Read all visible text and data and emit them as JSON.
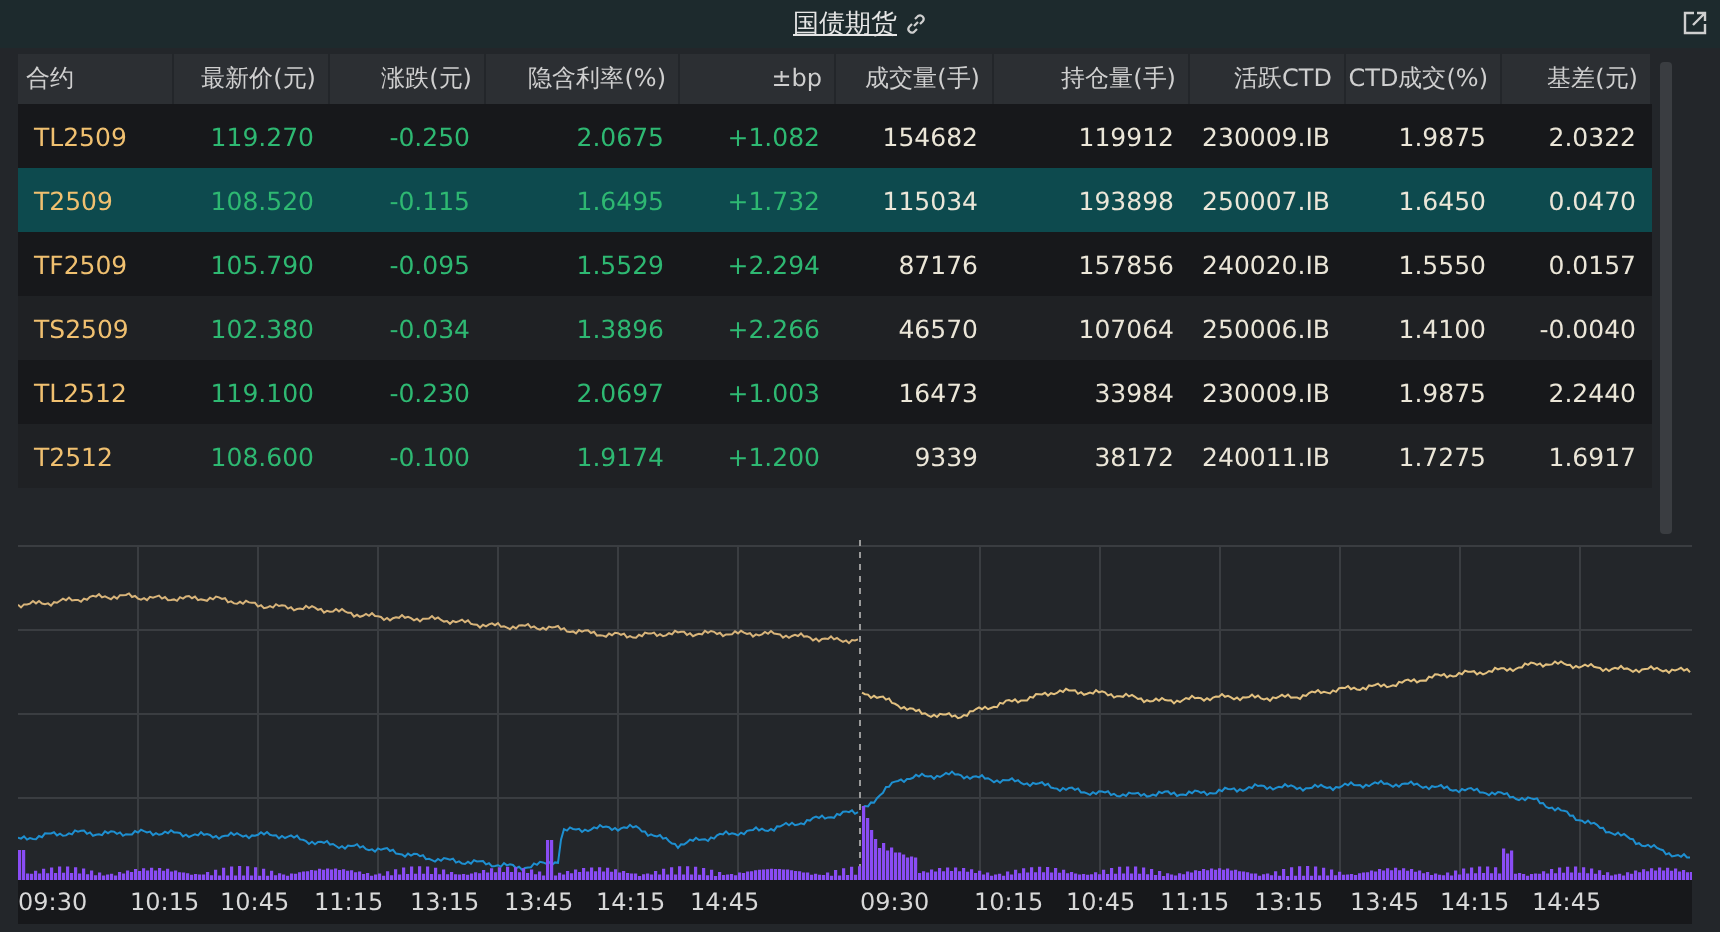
{
  "panel": {
    "title": "国债期货"
  },
  "table": {
    "columns": [
      "合约",
      "最新价(元)",
      "涨跌(元)",
      "隐含利率(%)",
      "±bp",
      "成交量(手)",
      "持仓量(手)",
      "活跃CTD",
      "CTD成交(%)",
      "基差(元)"
    ],
    "rows": [
      {
        "selected": false,
        "cells": [
          "TL2509",
          "119.270",
          "-0.250",
          "2.0675",
          "+1.082",
          "154682",
          "119912",
          "230009.IB",
          "1.9875",
          "2.0322"
        ]
      },
      {
        "selected": true,
        "cells": [
          "T2509",
          "108.520",
          "-0.115",
          "1.6495",
          "+1.732",
          "115034",
          "193898",
          "250007.IB",
          "1.6450",
          "0.0470"
        ]
      },
      {
        "selected": false,
        "cells": [
          "TF2509",
          "105.790",
          "-0.095",
          "1.5529",
          "+2.294",
          "87176",
          "157856",
          "240020.IB",
          "1.5550",
          "0.0157"
        ]
      },
      {
        "selected": false,
        "cells": [
          "TS2509",
          "102.380",
          "-0.034",
          "1.3896",
          "+2.266",
          "46570",
          "107064",
          "250006.IB",
          "1.4100",
          "-0.0040"
        ]
      },
      {
        "selected": false,
        "cells": [
          "TL2512",
          "119.100",
          "-0.230",
          "2.0697",
          "+1.003",
          "16473",
          "33984",
          "230009.IB",
          "1.9875",
          "2.2440"
        ]
      },
      {
        "selected": false,
        "cells": [
          "T2512",
          "108.600",
          "-0.100",
          "1.9174",
          "+1.200",
          "9339",
          "38172",
          "240011.IB",
          "1.7275",
          "1.6917"
        ]
      }
    ]
  },
  "time_axis": [
    "09:30",
    "10:15",
    "10:45",
    "11:15",
    "13:15",
    "13:45",
    "14:15",
    "14:45",
    "09:30",
    "10:15",
    "10:45",
    "11:15",
    "13:15",
    "13:45",
    "14:15",
    "14:45"
  ]
}
